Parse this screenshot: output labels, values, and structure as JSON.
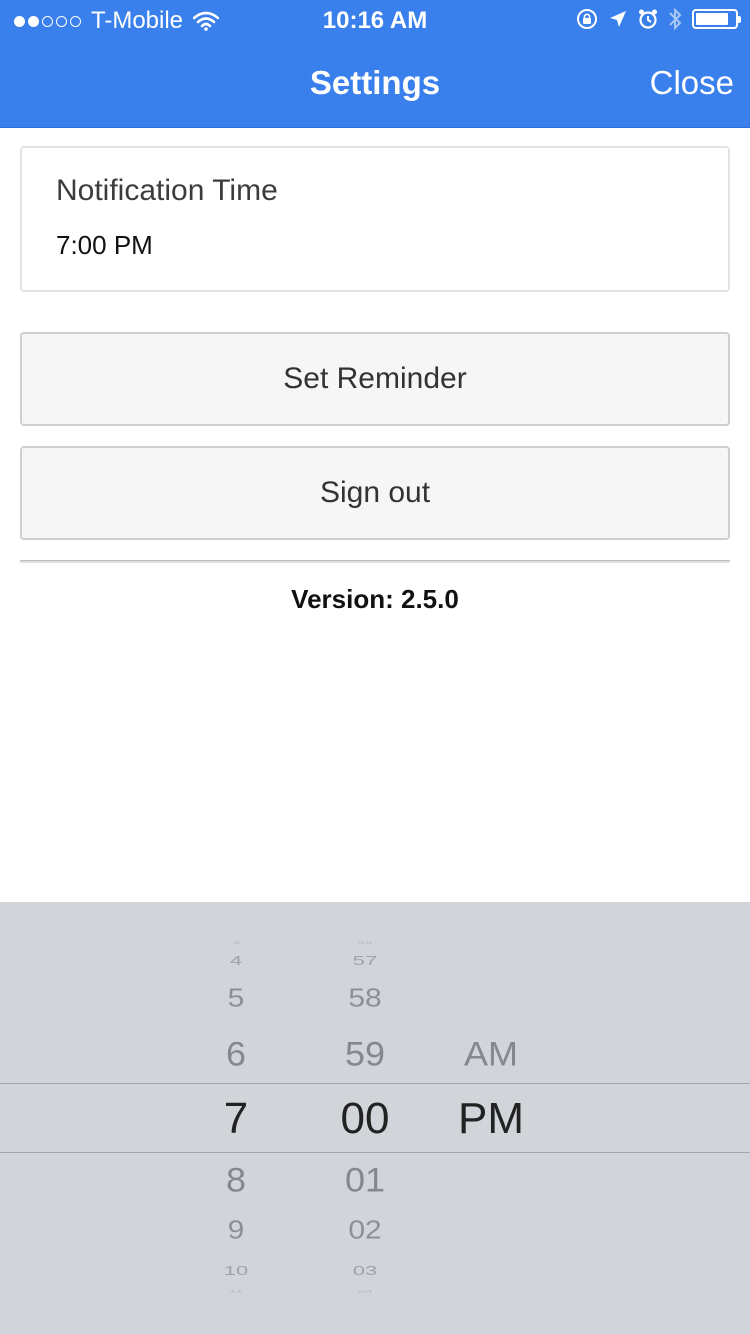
{
  "status_bar": {
    "carrier": "T-Mobile",
    "time": "10:16 AM",
    "signal_bars_filled": 2,
    "signal_bars_total": 5,
    "battery_level": 0.85
  },
  "nav": {
    "title": "Settings",
    "close_label": "Close"
  },
  "notification": {
    "label": "Notification Time",
    "value": "7:00 PM"
  },
  "buttons": {
    "set_reminder": "Set Reminder",
    "sign_out": "Sign out"
  },
  "version_text": "Version: 2.5.0",
  "picker": {
    "hours": [
      "3",
      "4",
      "5",
      "6",
      "7",
      "8",
      "9",
      "10",
      "11"
    ],
    "minutes": [
      "56",
      "57",
      "58",
      "59",
      "00",
      "01",
      "02",
      "03",
      "04"
    ],
    "periods": [
      "AM",
      "PM"
    ],
    "selected": {
      "hour": "7",
      "minute": "00",
      "period": "PM"
    }
  },
  "colors": {
    "nav_background": "#3a80ec",
    "picker_background": "#d1d4d9"
  }
}
